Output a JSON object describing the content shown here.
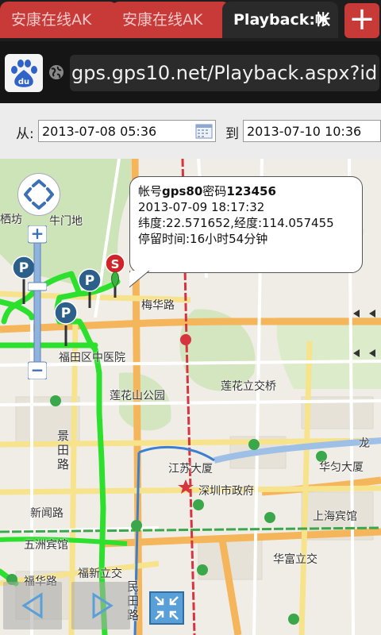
{
  "browser": {
    "tabs": [
      {
        "title": "安康在线AK"
      },
      {
        "title": "安康在线AK"
      },
      {
        "title": "Playback:帐"
      }
    ],
    "new_tab_label": "+",
    "close_label": "×",
    "url": "gps.gps10.net/Playback.aspx?id"
  },
  "dates": {
    "from_label": "从:",
    "from_value": "2013-07-08 05:36",
    "to_label": "到",
    "to_value": "2013-07-10 10:36"
  },
  "popup": {
    "account_prefix": "帐号",
    "account_id": "gps80",
    "password_label": "密码",
    "password_value": "123456",
    "datetime": "2013-07-09 18:17:32",
    "coords": "纬度:22.571652,经度:114.057455",
    "stay": "停留时间:16小时54分钟"
  },
  "map": {
    "labels": {
      "qisi": "栖坊",
      "niumen": "牛门地",
      "meihua": "梅华路",
      "futian_hospital": "福田区中医院",
      "lianhuashan": "莲花山公园",
      "lianhua_interchange": "莲花立交桥",
      "jingtian": "景田路",
      "jiangsu": "江苏大厦",
      "city_hall": "深圳市政府",
      "huayun": "华匀大厦",
      "xinwen": "新闻路",
      "shanghai_hotel": "上海宾馆",
      "wuzhou": "五洲宾馆",
      "huafu": "华富立交",
      "fuxin": "福新立交",
      "fuhua": "福华路",
      "minyi": "民田路",
      "long": "龙",
      "marker_s": "S",
      "marker_p": "P",
      "zoom_in": "+",
      "zoom_out": "−"
    },
    "colors": {
      "track": "#2ee02e",
      "marker_p": "#2c5f8a",
      "marker_s": "#d0242a",
      "tab_active": "#2a2a2a",
      "tab_inactive": "#c73a38"
    }
  }
}
